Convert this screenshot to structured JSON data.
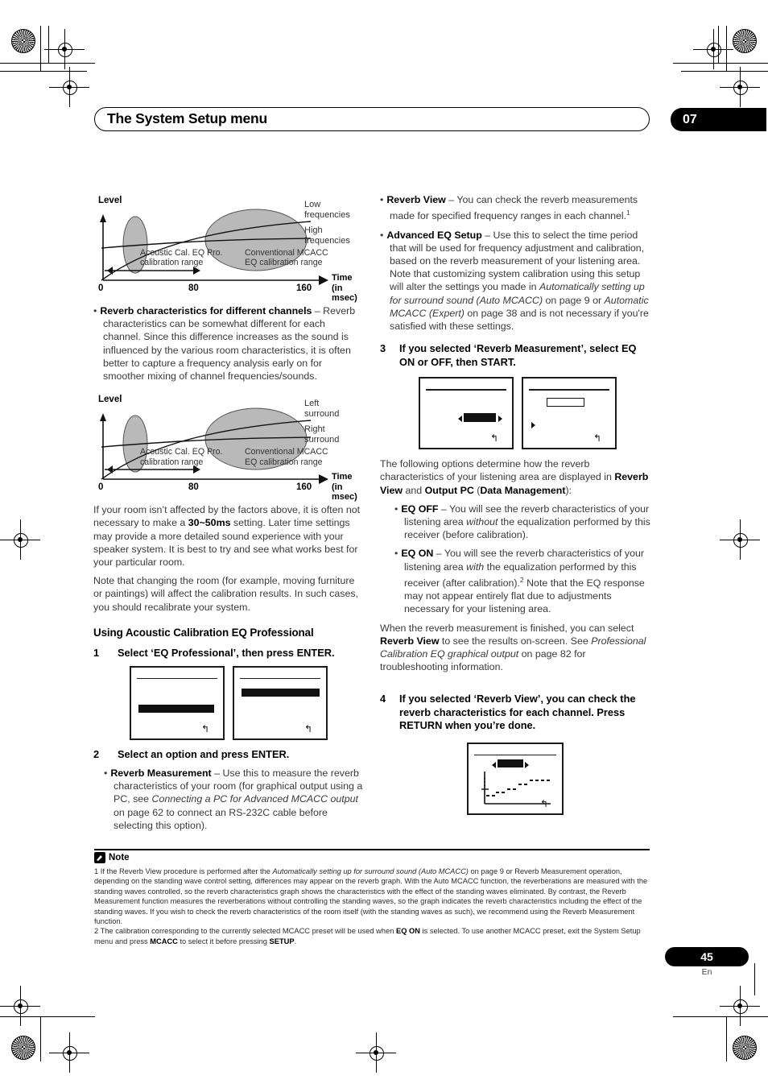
{
  "header": {
    "title": "The System Setup menu",
    "chapter": "07"
  },
  "figures": [
    {
      "name": "reverb-graph-frequencies",
      "axis_y_label": "Level",
      "axis_x_label": "Time",
      "axis_x_unit": "(in msec)",
      "ticks": [
        "0",
        "80",
        "160"
      ],
      "curve_labels": [
        "Low\nfrequencies",
        "High\nfrequencies"
      ],
      "curve_label_1_line1": "Low",
      "curve_label_1_line2": "frequencies",
      "curve_label_2_line1": "High",
      "curve_label_2_line2": "frequencies",
      "annot_left_line1": "Acoustic Cal. EQ Pro.",
      "annot_left_line2": "calibration range",
      "annot_right_line1": "Conventional MCACC",
      "annot_right_line2": "EQ calibration range"
    },
    {
      "name": "reverb-graph-surround",
      "axis_y_label": "Level",
      "axis_x_label": "Time",
      "axis_x_unit": "(in msec)",
      "ticks": [
        "0",
        "80",
        "160"
      ],
      "curve_label_1_line1": "Left",
      "curve_label_1_line2": "surround",
      "curve_label_2_line1": "Right",
      "curve_label_2_line2": "surround",
      "annot_left_line1": "Acoustic Cal. EQ Pro.",
      "annot_left_line2": "calibration range",
      "annot_right_line1": "Conventional MCACC",
      "annot_right_line2": "EQ calibration range"
    }
  ],
  "left_column": {
    "bullet_channels_title": "Reverb characteristics for different channels",
    "bullet_channels_body": " – Reverb characteristics can be somewhat different for each channel. Since this difference increases as the sound is influenced by the various room characteristics, it is often better to capture a frequency analysis early on for smoother mixing of channel frequencies/sounds.",
    "para_room_1a": "If your room isn’t affected by the factors above, it is often not necessary to make a ",
    "para_room_bold": "30~50ms",
    "para_room_1b": " setting. Later time settings may provide a more detailed sound experience with your speaker system. It is best to try and see what works best for your particular room.",
    "para_room_2": "Note that changing the room (for example, moving furniture or paintings) will affect the calibration results. In such cases, you should recalibrate your system.",
    "section_heading": "Using Acoustic Calibration EQ Professional",
    "step1_num": "1",
    "step1_text": "Select ‘EQ Professional’, then press ENTER.",
    "step2_num": "2",
    "step2_text": "Select an option and press ENTER.",
    "bullet_reverb_meas_title": "Reverb Measurement",
    "bullet_reverb_meas_a": " – Use this to measure the reverb characteristics of your room (for graphical output using a PC, see ",
    "bullet_reverb_meas_italic": "Connecting a PC for Advanced MCACC output",
    "bullet_reverb_meas_b": " on page 62 to connect an RS-232C cable before selecting this option)."
  },
  "right_column": {
    "bullet_reverb_view_title": "Reverb View",
    "bullet_reverb_view_a": " – You can check the reverb measurements made for specified frequency ranges in each channel.",
    "bullet_reverb_view_sup": "1",
    "bullet_adv_eq_title": "Advanced EQ Setup",
    "bullet_adv_eq_a": " – Use this to select the time period that will be used for frequency adjustment and calibration, based on the reverb measurement of your listening area. Note that customizing system calibration using this setup will alter the settings you made in ",
    "bullet_adv_eq_italic1": "Automatically setting up for surround sound (Auto MCACC)",
    "bullet_adv_eq_b": " on page 9 or ",
    "bullet_adv_eq_italic2": "Automatic MCACC (Expert)",
    "bullet_adv_eq_c": " on page 38 and is not necessary if you're satisfied with these settings.",
    "step3_num": "3",
    "step3_text": "If you selected ‘Reverb Measurement’, select EQ ON or OFF, then START.",
    "para_options_a": "The following options determine how the reverb characteristics of your listening area are displayed in ",
    "para_options_b1": "Reverb View",
    "para_options_b2": " and ",
    "para_options_b3": "Output PC",
    "para_options_b4": " (",
    "para_options_b5": "Data Management",
    "para_options_b6": "):",
    "bullet_eq_off_title": "EQ OFF",
    "bullet_eq_off_a": " – You will see the reverb characteristics of your listening area ",
    "bullet_eq_off_italic": "without",
    "bullet_eq_off_b": " the equalization performed by this receiver (before calibration).",
    "bullet_eq_on_title": "EQ ON",
    "bullet_eq_on_a": " – You will see the reverb characteristics of your listening area ",
    "bullet_eq_on_italic": "with",
    "bullet_eq_on_b": " the equalization performed by this receiver (after calibration).",
    "bullet_eq_on_sup": "2",
    "bullet_eq_on_c": " Note that the EQ response may not appear entirely flat due to adjustments necessary for your listening area.",
    "para_finished_a": "When the reverb measurement is finished, you can select ",
    "para_finished_b": "Reverb View",
    "para_finished_c": " to see the results on-screen. See ",
    "para_finished_italic": "Professional Calibration EQ graphical output",
    "para_finished_d": " on page 82 for troubleshooting information.",
    "step4_num": "4",
    "step4_text": "If you selected ‘Reverb View’, you can check the reverb characteristics for each channel. Press RETURN when you’re done."
  },
  "screens": {
    "return_glyph": "↰"
  },
  "notes": {
    "heading": "Note",
    "note1": "1 If the Reverb View procedure is performed after the Automatically setting up for surround sound (Auto MCACC) on page 9 or Reverb Measurement operation, depending on the standing wave control setting, differences may appear on the reverb graph. With the Auto MCACC function, the reverberations are measured with the standing waves controlled, so the reverb characteristics graph shows the characteristics with the effect of the standing waves eliminated. By contrast, the Reverb Measurement function measures the reverberations without controlling the standing waves, so the graph indicates the reverb characteristics including the effect of the standing waves. If you wish to check the reverb characteristics of the room itself (with the standing waves as such), we recommend using the Reverb Measurement function.",
    "note1_italic": "Automatically setting up for surround sound (Auto MCACC)",
    "note2_a": "2 The calibration corresponding to the currently selected MCACC preset will be used when ",
    "note2_b": "EQ ON",
    "note2_c": " is selected. To use another MCACC preset, exit the System Setup menu and press ",
    "note2_d": "MCACC",
    "note2_e": " to select it before pressing ",
    "note2_f": "SETUP",
    "note2_g": "."
  },
  "footer": {
    "page_number": "45",
    "language": "En"
  }
}
